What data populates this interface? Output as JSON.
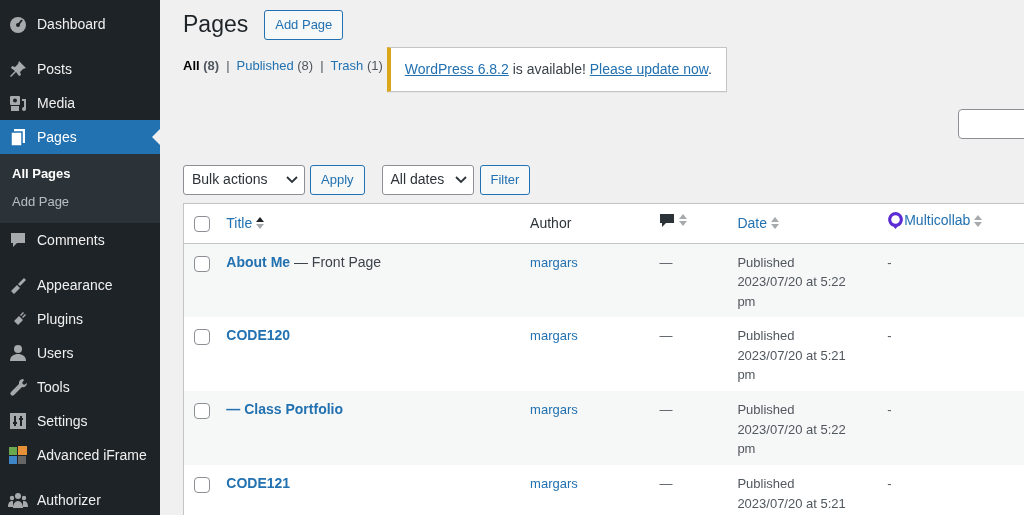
{
  "sidebar": {
    "groups": [
      [
        {
          "label": "Dashboard",
          "selected": false
        }
      ],
      [
        {
          "label": "Posts",
          "selected": false
        },
        {
          "label": "Media",
          "selected": false
        },
        {
          "label": "Pages",
          "selected": true,
          "children": [
            {
              "label": "All Pages",
              "selected": true
            },
            {
              "label": "Add Page",
              "selected": false
            }
          ]
        },
        {
          "label": "Comments",
          "selected": false
        }
      ],
      [
        {
          "label": "Appearance",
          "selected": false
        },
        {
          "label": "Plugins",
          "selected": false
        },
        {
          "label": "Users",
          "selected": false
        },
        {
          "label": "Tools",
          "selected": false
        },
        {
          "label": "Settings",
          "selected": false
        },
        {
          "label": "Advanced iFrame",
          "selected": false
        }
      ],
      [
        {
          "label": "Authorizer",
          "selected": false
        }
      ]
    ]
  },
  "page_title": "Pages",
  "add_button": "Add Page",
  "views": [
    {
      "label": "All",
      "count": "(8)",
      "selected": true,
      "separator": "|"
    },
    {
      "label": "Published",
      "count": "(8)",
      "selected": false,
      "separator": "|"
    },
    {
      "label": "Trash",
      "count": "(1)",
      "selected": false
    }
  ],
  "notice": [
    {
      "text": "WordPress 6.8.2",
      "kind": "link"
    },
    {
      "text": " is available! ",
      "kind": "text"
    },
    {
      "text": "Please update now",
      "kind": "link"
    },
    {
      "text": ".",
      "kind": "text"
    }
  ],
  "toolbar": {
    "bulk_select": "Bulk actions",
    "apply": "Apply",
    "date_select": "All dates",
    "filter": "Filter"
  },
  "table": {
    "header_checked": false,
    "columns": [
      {
        "kind": "title",
        "label": "Title",
        "sortable": true,
        "sorted": true
      },
      {
        "kind": "author",
        "label": "Author",
        "sortable": false
      },
      {
        "kind": "comments",
        "sortable": true,
        "sorted": false
      },
      {
        "kind": "date",
        "label": "Date",
        "sortable": true,
        "sorted": false
      },
      {
        "kind": "multicollab",
        "label": "Multicollab",
        "sortable": true,
        "sorted": false
      }
    ],
    "rows": [
      {
        "checked": false,
        "title": "About Me",
        "state": " — Front Page",
        "author": "margars",
        "comments": "—",
        "status": "Published",
        "date": "2023/07/20 at 5:22 pm",
        "multicollab": "-"
      },
      {
        "checked": false,
        "title": "CODE120",
        "author": "margars",
        "comments": "—",
        "status": "Published",
        "date": "2023/07/20 at 5:21 pm",
        "multicollab": "-"
      },
      {
        "checked": false,
        "title": "— Class Portfolio",
        "author": "margars",
        "comments": "—",
        "status": "Published",
        "date": "2023/07/20 at 5:22 pm",
        "multicollab": "-"
      },
      {
        "checked": false,
        "title": "CODE121",
        "author": "margars",
        "comments": "—",
        "status": "Published",
        "date": "2023/07/20 at 5:21",
        "multicollab": "-"
      }
    ]
  }
}
